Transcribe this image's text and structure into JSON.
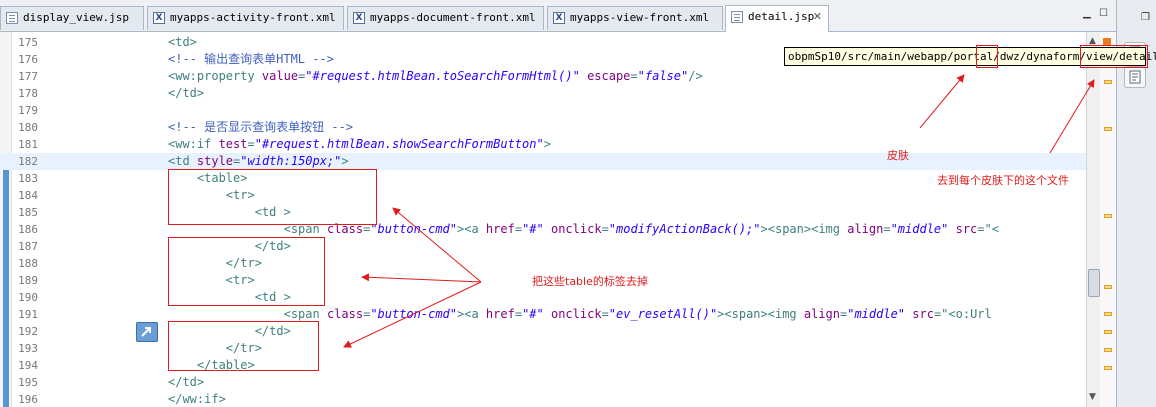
{
  "tabs": [
    {
      "label": "display_view.jsp",
      "icon": "jsp-file-icon"
    },
    {
      "label": "myapps-activity-front.xml",
      "icon": "xml-file-icon"
    },
    {
      "label": "myapps-document-front.xml",
      "icon": "xml-file-icon"
    },
    {
      "label": "myapps-view-front.xml",
      "icon": "xml-file-icon"
    },
    {
      "label": "detail.jsp",
      "icon": "jsp-file-icon",
      "active": true,
      "close": "✕"
    }
  ],
  "tooltip": {
    "path_parts": [
      "obpmSp10/src/main/webapp/portal/",
      "dwz",
      "/dynaform/view/",
      "detail.jsp"
    ]
  },
  "annotations": {
    "skin": "皮肤",
    "each_skin_file": "去到每个皮肤下的这个文件",
    "remove_table_tags": "把这些table的标签去掉"
  },
  "lines": [
    {
      "n": "175",
      "tokens": [
        [
          "tg",
          "<td>"
        ]
      ]
    },
    {
      "n": "176",
      "tokens": [
        [
          "cm",
          "<!-- 输出查询表单HTML -->"
        ]
      ]
    },
    {
      "n": "177",
      "tokens": [
        [
          "tg",
          "<ww:property "
        ],
        [
          "an",
          "value"
        ],
        [
          "tg",
          "="
        ],
        [
          "av",
          "\"#request.htmlBean.toSearchFormHtml()\""
        ],
        [
          "tg",
          " "
        ],
        [
          "an",
          "escape"
        ],
        [
          "tg",
          "="
        ],
        [
          "av",
          "\"false\""
        ],
        [
          "tg",
          "/>"
        ]
      ]
    },
    {
      "n": "178",
      "tokens": [
        [
          "tg",
          "</td>"
        ]
      ]
    },
    {
      "n": "179",
      "tokens": []
    },
    {
      "n": "180",
      "tokens": [
        [
          "cm",
          "<!-- 是否显示查询表单按钮 -->"
        ]
      ]
    },
    {
      "n": "181",
      "tokens": [
        [
          "tg",
          "<ww:if "
        ],
        [
          "an",
          "test"
        ],
        [
          "tg",
          "="
        ],
        [
          "av",
          "\"#request.htmlBean.showSearchFormButton\""
        ],
        [
          "tg",
          ">"
        ]
      ]
    },
    {
      "n": "182",
      "tokens": [
        [
          "tg",
          "<td "
        ],
        [
          "an",
          "style"
        ],
        [
          "tg",
          "="
        ],
        [
          "av",
          "\"width:150px;\""
        ],
        [
          "tg",
          ">"
        ]
      ],
      "current": true
    },
    {
      "n": "183",
      "tokens": [
        [
          "tg",
          "    <table>"
        ]
      ]
    },
    {
      "n": "184",
      "tokens": [
        [
          "tg",
          "        <tr>"
        ]
      ]
    },
    {
      "n": "185",
      "tokens": [
        [
          "tg",
          "            <td >"
        ]
      ]
    },
    {
      "n": "186",
      "tokens": [
        [
          "tg",
          "                <span "
        ],
        [
          "an",
          "class"
        ],
        [
          "tg",
          "="
        ],
        [
          "av",
          "\"button-cmd\""
        ],
        [
          "tg",
          "><a "
        ],
        [
          "an",
          "href"
        ],
        [
          "tg",
          "="
        ],
        [
          "av",
          "\"#\""
        ],
        [
          "tg",
          " "
        ],
        [
          "an",
          "onclick"
        ],
        [
          "tg",
          "="
        ],
        [
          "av",
          "\"modifyActionBack();\""
        ],
        [
          "tg",
          "><span><img "
        ],
        [
          "an",
          "align"
        ],
        [
          "tg",
          "="
        ],
        [
          "av",
          "\"middle\""
        ],
        [
          "tg",
          " "
        ],
        [
          "an",
          "src"
        ],
        [
          "tg",
          "=\"<"
        ]
      ]
    },
    {
      "n": "187",
      "tokens": [
        [
          "tg",
          "            </td>"
        ]
      ]
    },
    {
      "n": "188",
      "tokens": [
        [
          "tg",
          "        </tr>"
        ]
      ]
    },
    {
      "n": "189",
      "tokens": [
        [
          "tg",
          "        <tr>"
        ]
      ]
    },
    {
      "n": "190",
      "tokens": [
        [
          "tg",
          "            <td >"
        ]
      ]
    },
    {
      "n": "191",
      "tokens": [
        [
          "tg",
          "                <span "
        ],
        [
          "an",
          "class"
        ],
        [
          "tg",
          "="
        ],
        [
          "av",
          "\"button-cmd\""
        ],
        [
          "tg",
          "><a "
        ],
        [
          "an",
          "href"
        ],
        [
          "tg",
          "="
        ],
        [
          "av",
          "\"#\""
        ],
        [
          "tg",
          " "
        ],
        [
          "an",
          "onclick"
        ],
        [
          "tg",
          "="
        ],
        [
          "av",
          "\"ev_resetAll()\""
        ],
        [
          "tg",
          "><span><img "
        ],
        [
          "an",
          "align"
        ],
        [
          "tg",
          "="
        ],
        [
          "av",
          "\"middle\""
        ],
        [
          "tg",
          " "
        ],
        [
          "an",
          "src"
        ],
        [
          "tg",
          "=\"<o:Url"
        ]
      ]
    },
    {
      "n": "192",
      "tokens": [
        [
          "tg",
          "            </td>"
        ]
      ]
    },
    {
      "n": "193",
      "tokens": [
        [
          "tg",
          "        </tr>"
        ]
      ]
    },
    {
      "n": "194",
      "tokens": [
        [
          "tg",
          "    </table>"
        ]
      ]
    },
    {
      "n": "195",
      "tokens": [
        [
          "tg",
          "</td>"
        ]
      ]
    },
    {
      "n": "196",
      "tokens": [
        [
          "tg",
          "</ww:if>"
        ]
      ]
    }
  ],
  "colors": {
    "tag": "#3f7f7f",
    "attr": "#7f007f",
    "value": "#2a00ff",
    "comment": "#3f5fbf",
    "annotation": "#e21c1c"
  }
}
